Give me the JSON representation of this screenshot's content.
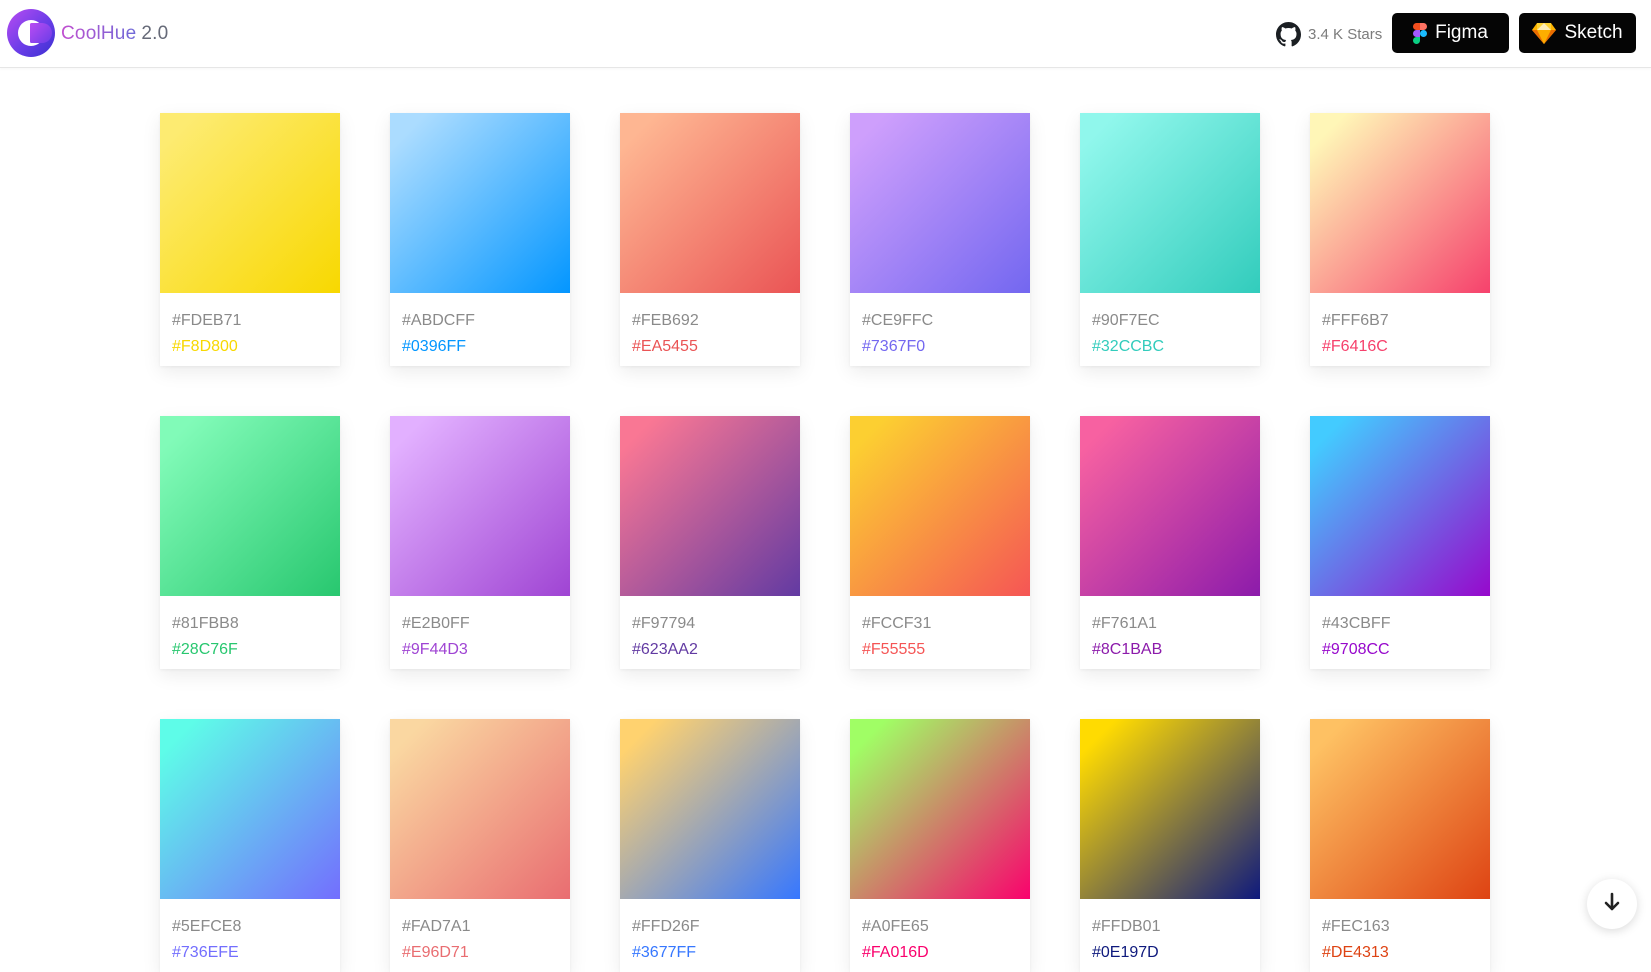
{
  "header": {
    "brand_name": "CoolHue",
    "brand_version": "2.0",
    "github_stars": "3.4 K Stars",
    "figma_label": "Figma",
    "sketch_label": "Sketch"
  },
  "colors": {
    "button_bg": "#050505",
    "muted_text": "#8a8a8a"
  },
  "gradients": [
    {
      "from": "#FDEB71",
      "to": "#F8D800"
    },
    {
      "from": "#ABDCFF",
      "to": "#0396FF"
    },
    {
      "from": "#FEB692",
      "to": "#EA5455"
    },
    {
      "from": "#CE9FFC",
      "to": "#7367F0"
    },
    {
      "from": "#90F7EC",
      "to": "#32CCBC"
    },
    {
      "from": "#FFF6B7",
      "to": "#F6416C"
    },
    {
      "from": "#81FBB8",
      "to": "#28C76F"
    },
    {
      "from": "#E2B0FF",
      "to": "#9F44D3"
    },
    {
      "from": "#F97794",
      "to": "#623AA2"
    },
    {
      "from": "#FCCF31",
      "to": "#F55555"
    },
    {
      "from": "#F761A1",
      "to": "#8C1BAB"
    },
    {
      "from": "#43CBFF",
      "to": "#9708CC"
    },
    {
      "from": "#5EFCE8",
      "to": "#736EFE"
    },
    {
      "from": "#FAD7A1",
      "to": "#E96D71"
    },
    {
      "from": "#FFD26F",
      "to": "#3677FF"
    },
    {
      "from": "#A0FE65",
      "to": "#FA016D"
    },
    {
      "from": "#FFDB01",
      "to": "#0E197D"
    },
    {
      "from": "#FEC163",
      "to": "#DE4313"
    }
  ],
  "icons": {
    "github": "github-icon",
    "figma": "figma-icon",
    "sketch": "sketch-icon",
    "scroll": "arrow-down-icon"
  }
}
